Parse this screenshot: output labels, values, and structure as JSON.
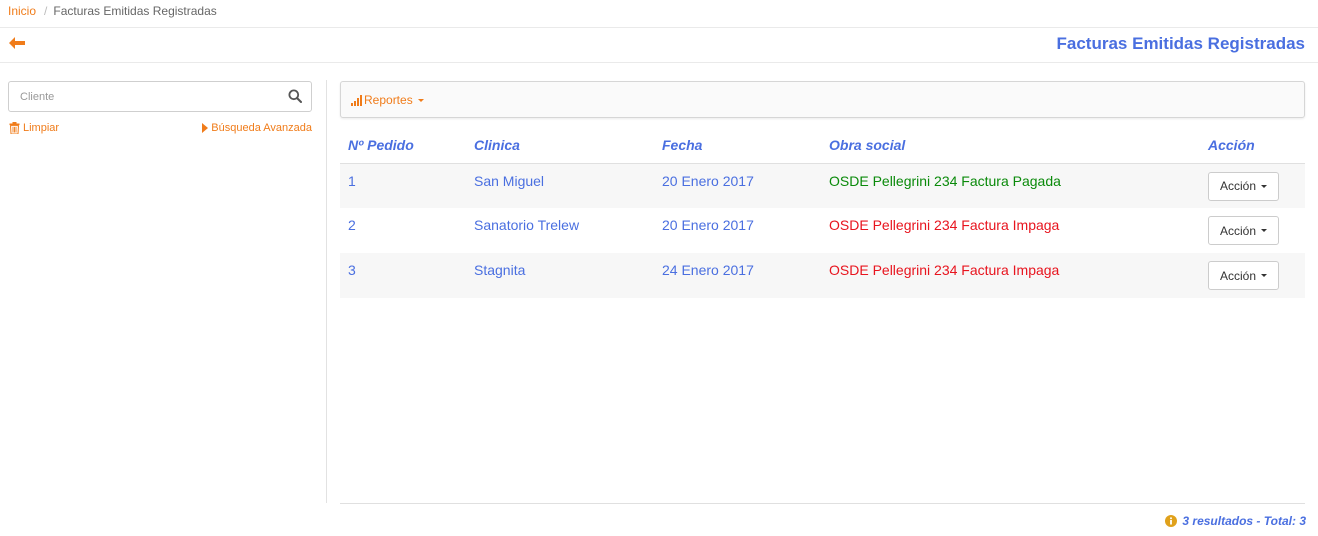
{
  "breadcrumb": {
    "home": "Inicio",
    "current": "Facturas Emitidas Registradas"
  },
  "header": {
    "title": "Facturas Emitidas Registradas"
  },
  "sidebar": {
    "search_placeholder": "Cliente",
    "clear_label": "Limpiar",
    "advanced_label": "Búsqueda Avanzada"
  },
  "toolbar": {
    "reports_label": "Reportes"
  },
  "table": {
    "headers": [
      "Nº Pedido",
      "Clinica",
      "Fecha",
      "Obra social",
      "Acción"
    ],
    "rows": [
      {
        "pedido": "1",
        "clinica": "San Miguel",
        "fecha": "20 Enero 2017",
        "obra_social": "OSDE Pellegrini 234 Factura Pagada",
        "estado": "paid",
        "accion": "Acción"
      },
      {
        "pedido": "2",
        "clinica": "Sanatorio Trelew",
        "fecha": "20 Enero 2017",
        "obra_social": "OSDE Pellegrini 234 Factura Impaga",
        "estado": "unpaid",
        "accion": "Acción"
      },
      {
        "pedido": "3",
        "clinica": "Stagnita",
        "fecha": "24 Enero 2017",
        "obra_social": "OSDE Pellegrini 234 Factura Impaga",
        "estado": "unpaid",
        "accion": "Acción"
      }
    ]
  },
  "footer": {
    "results_text": "3 resultados - Total: 3"
  },
  "colors": {
    "accent": "#f07c1a",
    "primary": "#4a6fe0",
    "paid": "#0a8a0a",
    "unpaid": "#e8141e"
  },
  "icons": [
    "arrow-left-icon",
    "search-icon",
    "trash-icon",
    "caret-right-icon",
    "bar-chart-icon",
    "caret-down-icon",
    "info-icon"
  ]
}
